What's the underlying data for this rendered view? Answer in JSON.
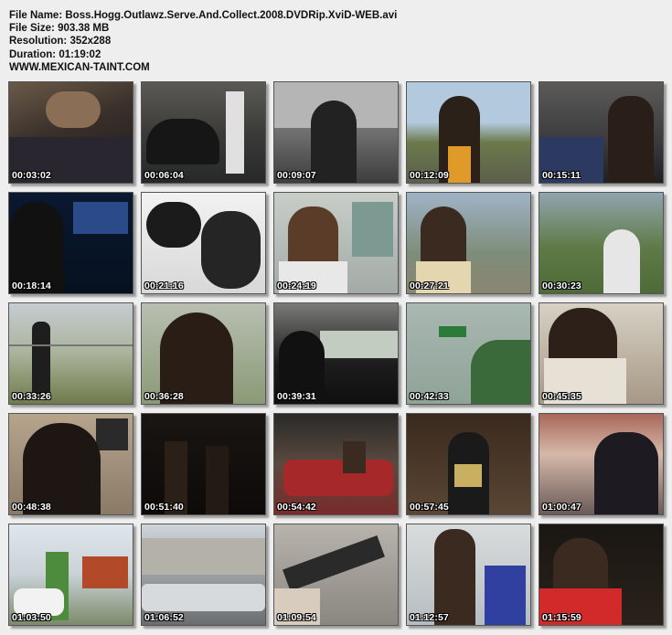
{
  "file_info": {
    "name_label": "File Name:",
    "name_value": "Boss.Hogg.Outlawz.Serve.And.Collect.2008.DVDRip.XviD-WEB.avi",
    "size_label": "File Size:",
    "size_value": "903.38 MB",
    "resolution_label": "Resolution:",
    "resolution_value": "352x288",
    "duration_label": "Duration:",
    "duration_value": "01:19:02",
    "website": "WWW.MEXICAN-TAINT.COM"
  },
  "thumbnails": [
    {
      "timestamp": "00:03:02"
    },
    {
      "timestamp": "00:06:04"
    },
    {
      "timestamp": "00:09:07"
    },
    {
      "timestamp": "00:12:09"
    },
    {
      "timestamp": "00:15:11"
    },
    {
      "timestamp": "00:18:14"
    },
    {
      "timestamp": "00:21:16"
    },
    {
      "timestamp": "00:24:19"
    },
    {
      "timestamp": "00:27:21"
    },
    {
      "timestamp": "00:30:23"
    },
    {
      "timestamp": "00:33:26"
    },
    {
      "timestamp": "00:36:28"
    },
    {
      "timestamp": "00:39:31"
    },
    {
      "timestamp": "00:42:33"
    },
    {
      "timestamp": "00:45:35"
    },
    {
      "timestamp": "00:48:38"
    },
    {
      "timestamp": "00:51:40"
    },
    {
      "timestamp": "00:54:42"
    },
    {
      "timestamp": "00:57:45"
    },
    {
      "timestamp": "01:00:47"
    },
    {
      "timestamp": "01:03:50"
    },
    {
      "timestamp": "01:06:52"
    },
    {
      "timestamp": "01:09:54"
    },
    {
      "timestamp": "01:12:57"
    },
    {
      "timestamp": "01:15:59"
    }
  ]
}
